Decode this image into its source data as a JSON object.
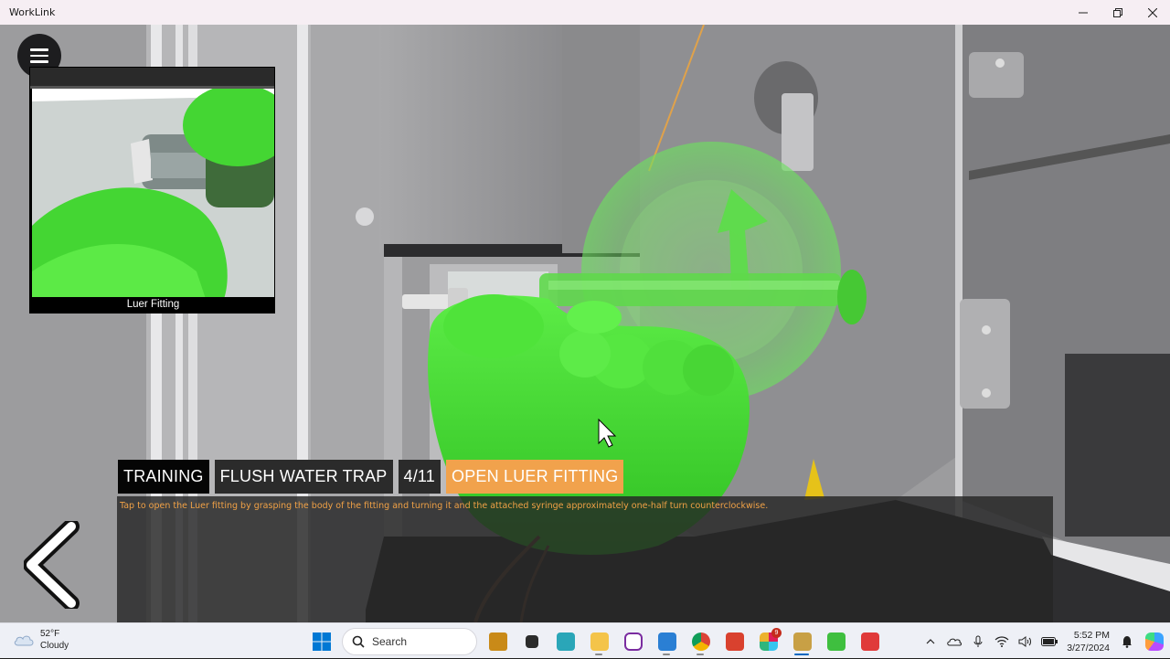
{
  "window": {
    "title": "WorkLink"
  },
  "inset": {
    "caption": "Luer Fitting"
  },
  "procedure": {
    "mode": "TRAINING",
    "task": "FLUSH WATER TRAP",
    "step": "4/11",
    "action": "OPEN LUER FITTING",
    "instruction": "Tap to open the Luer fitting by grasping the body of the fitting and turning it and the attached syringe approximately one-half turn counterclockwise."
  },
  "taskbar": {
    "weather": {
      "temperature": "52°F",
      "condition": "Cloudy"
    },
    "search_placeholder": "Search",
    "pinned_icons": [
      "windows-start-icon",
      "search-icon",
      "briefcase-icon",
      "task-view-icon",
      "chat-icon",
      "file-explorer-icon",
      "app-purple-icon",
      "app-s-blue-icon",
      "chrome-icon",
      "app-s-red-icon",
      "slack-icon",
      "worklink-icon",
      "app-green-icon",
      "app-red-icon"
    ],
    "slack_badge": "9",
    "clock": {
      "time": "5:52 PM",
      "date": "3/27/2024"
    }
  },
  "colors": {
    "accent_orange": "#f1a24c",
    "hand_green": "#3ed62c",
    "title_bar": "#f6eef3"
  }
}
